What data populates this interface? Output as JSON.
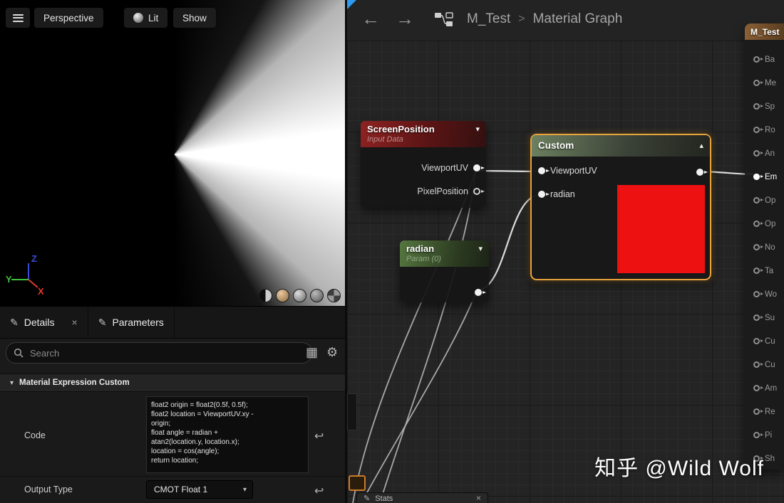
{
  "colors": {
    "selection_orange": "#E8A33D",
    "screen_position_header_red": "#8E2222",
    "custom_header_green": "#6D8160",
    "radian_header_green": "#55763F",
    "material_header_brown": "#8A6036",
    "preview_red": "#EE1111",
    "wire": "#D6D6D6",
    "panel_bg": "#1A1A1A",
    "graph_bg": "#242424",
    "axis_x": "#E03A2A",
    "axis_y": "#3EC43E",
    "axis_z": "#3B4BD8",
    "active_tab_marker_blue": "#2E9BF0"
  },
  "icons": {
    "chevron_down": "▾",
    "chevron_up": "▴",
    "triangle_down": "▾",
    "close": "×",
    "pen": "✎",
    "gear": "⚙",
    "grid": "▦",
    "revert": "↩",
    "back_arrow": "←",
    "forward_arrow": "→"
  },
  "viewport": {
    "perspective_label": "Perspective",
    "lit_label": "Lit",
    "show_label": "Show",
    "axis": {
      "x": "X",
      "y": "Y",
      "z": "Z"
    }
  },
  "details": {
    "tabs": [
      {
        "label": "Details"
      },
      {
        "label": "Parameters"
      }
    ],
    "search_placeholder": "Search",
    "section_title": "Material Expression Custom",
    "code_label": "Code",
    "code_value": "float2 origin = float2(0.5f, 0.5f);\nfloat2 location = ViewportUV.xy -\norigin;\nfloat angle = radian +\natan2(location.y, location.x);\nlocation = cos(angle);\nreturn location;",
    "output_type_label": "Output Type",
    "output_type_value": "CMOT Float 1"
  },
  "graph": {
    "breadcrumb": {
      "root": "M_Test",
      "separator": ">",
      "current": "Material Graph"
    },
    "nodes": {
      "screen_position": {
        "title": "ScreenPosition",
        "subtitle": "Input Data",
        "outputs": [
          "ViewportUV",
          "PixelPosition"
        ]
      },
      "custom": {
        "title": "Custom",
        "inputs": [
          "ViewportUV",
          "radian"
        ]
      },
      "radian": {
        "title": "radian",
        "subtitle": "Param (0)"
      }
    },
    "material_node": {
      "title": "M_Test",
      "pins": [
        {
          "label": "Ba",
          "connected": false
        },
        {
          "label": "Me",
          "connected": false
        },
        {
          "label": "Sp",
          "connected": false
        },
        {
          "label": "Ro",
          "connected": false
        },
        {
          "label": "An",
          "connected": false
        },
        {
          "label": "Em",
          "connected": true
        },
        {
          "label": "Op",
          "connected": false
        },
        {
          "label": "Op",
          "connected": false
        },
        {
          "label": "No",
          "connected": false
        },
        {
          "label": "Ta",
          "connected": false
        },
        {
          "label": "Wo",
          "connected": false
        },
        {
          "label": "Su",
          "connected": false
        },
        {
          "label": "Cu",
          "connected": false
        },
        {
          "label": "Cu",
          "connected": false
        },
        {
          "label": "Am",
          "connected": false
        },
        {
          "label": "Re",
          "connected": false
        },
        {
          "label": "Pi",
          "connected": false
        },
        {
          "label": "Sh",
          "connected": false
        }
      ]
    },
    "stats_tab_label": "Stats"
  },
  "watermark": "知乎 @Wild Wolf"
}
